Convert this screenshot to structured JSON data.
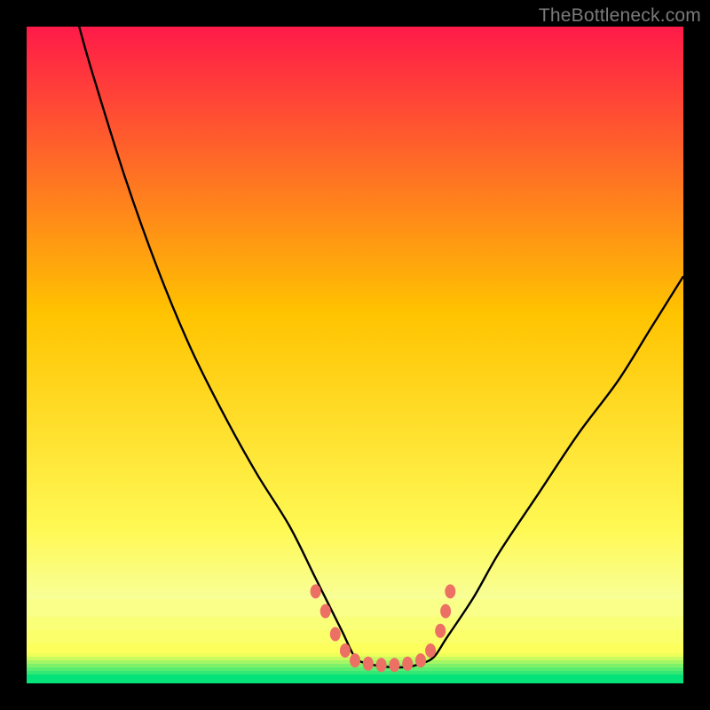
{
  "watermark": "TheBottleneck.com",
  "colors": {
    "gradient_top": "#ff1a49",
    "gradient_mid": "#ffc300",
    "gradient_low": "#fff955",
    "band_green": "#05e27a",
    "marker": "#ec7063",
    "curve": "#000000",
    "frame": "#000000"
  },
  "chart_data": {
    "type": "line",
    "title": "",
    "xlabel": "",
    "ylabel": "",
    "xlim": [
      0,
      100
    ],
    "ylim": [
      0,
      100
    ],
    "grid": false,
    "legend": false,
    "description": "Single black V-shaped curve on gradient. Y≈bottleneck magnitude; minimum plateau near x 50–60 at y≈3. Left branch rises to ≈100 at x≈8; right to ≈62 at x=100.",
    "series": [
      {
        "name": "bottleneck-curve",
        "x": [
          8,
          10,
          15,
          20,
          25,
          30,
          35,
          40,
          44,
          48,
          50,
          52,
          55,
          58,
          60,
          62,
          64,
          68,
          72,
          78,
          84,
          90,
          95,
          100
        ],
        "y": [
          100,
          93,
          77,
          63,
          51,
          41,
          32,
          24,
          16,
          8,
          4,
          3,
          2.5,
          2.5,
          3,
          4,
          7,
          13,
          20,
          29,
          38,
          46,
          54,
          62
        ]
      }
    ],
    "markers": {
      "name": "plateau-dots",
      "color": "#ec7063",
      "points": [
        {
          "x": 44,
          "y": 14
        },
        {
          "x": 45.5,
          "y": 11
        },
        {
          "x": 47,
          "y": 7.5
        },
        {
          "x": 48.5,
          "y": 5
        },
        {
          "x": 50,
          "y": 3.5
        },
        {
          "x": 52,
          "y": 3
        },
        {
          "x": 54,
          "y": 2.8
        },
        {
          "x": 56,
          "y": 2.8
        },
        {
          "x": 58,
          "y": 3
        },
        {
          "x": 60,
          "y": 3.5
        },
        {
          "x": 61.5,
          "y": 5
        },
        {
          "x": 63,
          "y": 8
        },
        {
          "x": 63.8,
          "y": 11
        },
        {
          "x": 64.5,
          "y": 14
        }
      ]
    }
  }
}
